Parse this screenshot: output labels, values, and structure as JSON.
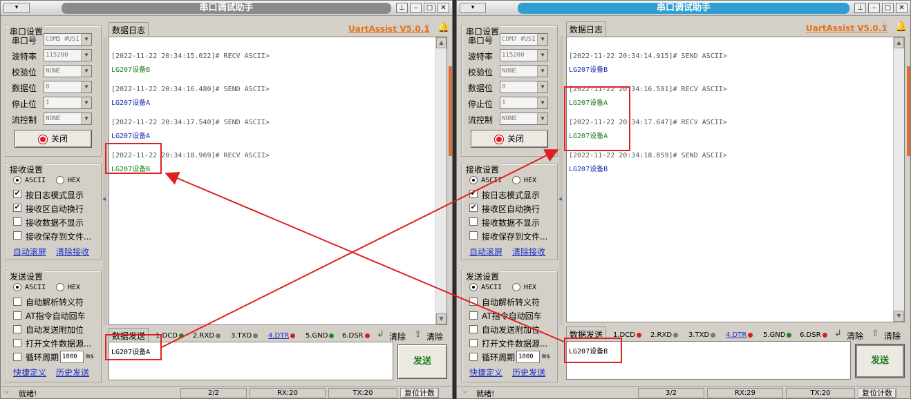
{
  "windows": [
    {
      "id": "left",
      "title": "串口调试助手",
      "serial": {
        "group_title": "串口设置",
        "fields": [
          {
            "label": "串口号",
            "value": "COM5 #USI"
          },
          {
            "label": "波特率",
            "value": "115200"
          },
          {
            "label": "校验位",
            "value": "NONE"
          },
          {
            "label": "数据位",
            "value": "8"
          },
          {
            "label": "停止位",
            "value": "1"
          },
          {
            "label": "流控制",
            "value": "NONE"
          }
        ],
        "close_button": "关闭"
      },
      "recv": {
        "group_title": "接收设置",
        "ascii": "ASCII",
        "hex": "HEX",
        "options": [
          {
            "label": "按日志模式显示",
            "checked": true
          },
          {
            "label": "接收区自动换行",
            "checked": true
          },
          {
            "label": "接收数据不显示",
            "checked": false
          },
          {
            "label": "接收保存到文件...",
            "checked": false
          }
        ],
        "links": [
          "自动滚屏",
          "清除接收"
        ]
      },
      "send": {
        "group_title": "发送设置",
        "ascii": "ASCII",
        "hex": "HEX",
        "options": [
          {
            "label": "自动解析转义符",
            "checked": false
          },
          {
            "label": "AT指令自动回车",
            "checked": false
          },
          {
            "label": "自动发送附加位",
            "checked": false
          },
          {
            "label": "打开文件数据源...",
            "checked": false
          },
          {
            "label": "循环周期",
            "checked": false
          }
        ],
        "period_value": "1000",
        "period_unit": "ms",
        "links": [
          "快捷定义",
          "历史发送"
        ]
      },
      "tab_log": "数据日志",
      "brand": "UartAssist V5.0.1",
      "log": [
        {
          "header": "[2022-11-22 20:34:15.022]# RECV ASCII>",
          "data": "LG207设备B",
          "kind": "recv"
        },
        {
          "header": "[2022-11-22 20:34:16.480]# SEND ASCII>",
          "data": "LG207设备A",
          "kind": "send"
        },
        {
          "header": "[2022-11-22 20:34:17.540]# SEND ASCII>",
          "data": "LG207设备A",
          "kind": "send"
        },
        {
          "header": "[2022-11-22 20:34:18.969]# RECV ASCII>",
          "data": "LG207设备B",
          "kind": "recv"
        }
      ],
      "tab_send": "数据发送",
      "pins": [
        {
          "label": "1.DCD",
          "color": "#1c8a1c"
        },
        {
          "label": "2.RXD",
          "color": "#777777"
        },
        {
          "label": "3.TXD",
          "color": "#777777"
        },
        {
          "label": "4.DTR",
          "color": "#d42020"
        },
        {
          "label": "5.GND",
          "color": "#1c8a1c"
        },
        {
          "label": "6.DSR",
          "color": "#d42020"
        }
      ],
      "clear1": "清除",
      "clear2": "清除",
      "send_text": "LG207设备A",
      "send_button": "发送",
      "status": {
        "ready": "就绪!",
        "page": "2/2",
        "rx": "RX:20",
        "tx": "TX:20",
        "reset": "复位计数"
      }
    },
    {
      "id": "right",
      "title": "串口调试助手",
      "serial": {
        "group_title": "串口设置",
        "fields": [
          {
            "label": "串口号",
            "value": "COM7 #USI"
          },
          {
            "label": "波特率",
            "value": "115200"
          },
          {
            "label": "校验位",
            "value": "NONE"
          },
          {
            "label": "数据位",
            "value": "8"
          },
          {
            "label": "停止位",
            "value": "1"
          },
          {
            "label": "流控制",
            "value": "NONE"
          }
        ],
        "close_button": "关闭"
      },
      "recv": {
        "group_title": "接收设置",
        "ascii": "ASCII",
        "hex": "HEX",
        "options": [
          {
            "label": "按日志模式显示",
            "checked": true
          },
          {
            "label": "接收区自动换行",
            "checked": true
          },
          {
            "label": "接收数据不显示",
            "checked": false
          },
          {
            "label": "接收保存到文件...",
            "checked": false
          }
        ],
        "links": [
          "自动滚屏",
          "清除接收"
        ]
      },
      "send": {
        "group_title": "发送设置",
        "ascii": "ASCII",
        "hex": "HEX",
        "options": [
          {
            "label": "自动解析转义符",
            "checked": false
          },
          {
            "label": "AT指令自动回车",
            "checked": false
          },
          {
            "label": "自动发送附加位",
            "checked": false
          },
          {
            "label": "打开文件数据源...",
            "checked": false
          },
          {
            "label": "循环周期",
            "checked": false
          }
        ],
        "period_value": "1000",
        "period_unit": "ms",
        "links": [
          "快捷定义",
          "历史发送"
        ]
      },
      "tab_log": "数据日志",
      "brand": "UartAssist V5.0.1",
      "log": [
        {
          "header": "[2022-11-22 20:34:14.915]# SEND ASCII>",
          "data": "LG207设备B",
          "kind": "send"
        },
        {
          "header": "[2022-11-22 20:34:16.591]# RECV ASCII>",
          "data": "LG207设备A",
          "kind": "recv"
        },
        {
          "header": "[2022-11-22 20:34:17.647]# RECV ASCII>",
          "data": "LG207设备A",
          "kind": "recv"
        },
        {
          "header": "[2022-11-22 20:34:18.859]# SEND ASCII>",
          "data": "LG207设备B",
          "kind": "send"
        }
      ],
      "tab_send": "数据发送",
      "pins": [
        {
          "label": "1.DCD",
          "color": "#d42020"
        },
        {
          "label": "2.RXD",
          "color": "#777777"
        },
        {
          "label": "3.TXD",
          "color": "#777777"
        },
        {
          "label": "4.DTR",
          "color": "#d42020"
        },
        {
          "label": "5.GND",
          "color": "#1c8a1c"
        },
        {
          "label": "6.DSR",
          "color": "#d42020"
        }
      ],
      "clear1": "清除",
      "clear2": "清除",
      "send_text": "LG207设备B",
      "send_button": "发送",
      "status": {
        "ready": "就绪!",
        "page": "3/2",
        "rx": "RX:29",
        "tx": "TX:20",
        "reset": "复位计数"
      }
    }
  ],
  "colors": {
    "annotation": "#e02020",
    "recv_text": "#1a7a1a",
    "send_text": "#1b2aa8",
    "brand": "#e5721b"
  }
}
